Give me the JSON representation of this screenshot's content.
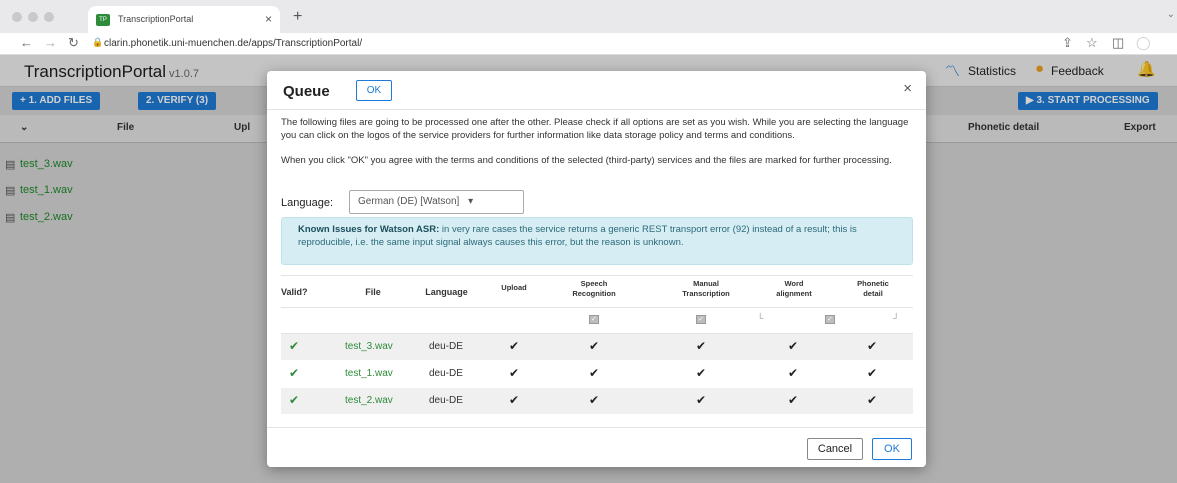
{
  "browser": {
    "tab_title": "TranscriptionPortal",
    "tab_close": "×",
    "new_tab": "+",
    "url": "clarin.phonetik.uni-muenchen.de/apps/TranscriptionPortal/"
  },
  "app": {
    "title": "TranscriptionPortal",
    "version": "v1.0.7",
    "statistics_label": "Statistics",
    "feedback_label": "Feedback",
    "add_files_label": "+ 1. ADD FILES",
    "verify_label": "2. VERIFY (3)",
    "start_processing_label": "▶ 3. START PROCESSING",
    "columns": {
      "file": "File",
      "upload": "Upl",
      "phonetic": "Phonetic detail",
      "export": "Export"
    },
    "files": [
      "test_3.wav",
      "test_1.wav",
      "test_2.wav"
    ]
  },
  "modal": {
    "title": "Queue",
    "ok_top": "OK",
    "close": "×",
    "intro": "The following files are going to be processed one after the other. Please check if all options are set as you wish. While you are selecting the language you can click on the logos of the service providers for further information like data storage policy and terms and conditions.",
    "agree": "When you click \"OK\" you agree with the terms and conditions of the selected (third-party) services and the files are marked for further processing.",
    "language_label": "Language:",
    "language_value": "German (DE) [Watson]",
    "alert_bold": "Known Issues for Watson ASR:",
    "alert_text": " in very rare cases the service returns a generic REST transport error (92) instead of a result; this is reproducible, i.e. the same input signal always causes this error, but the reason is unknown.",
    "table": {
      "headers": {
        "valid": "Valid?",
        "file": "File",
        "language": "Language",
        "upload": "Upload",
        "speech1": "Speech",
        "speech2": "Recognition",
        "manual1": "Manual",
        "manual2": "Transcription",
        "word1": "Word",
        "word2": "alignment",
        "phon1": "Phonetic",
        "phon2": "detail"
      },
      "rows": [
        {
          "file": "test_3.wav",
          "language": "deu-DE"
        },
        {
          "file": "test_1.wav",
          "language": "deu-DE"
        },
        {
          "file": "test_2.wav",
          "language": "deu-DE"
        }
      ]
    },
    "cancel_label": "Cancel",
    "ok_label": "OK"
  }
}
